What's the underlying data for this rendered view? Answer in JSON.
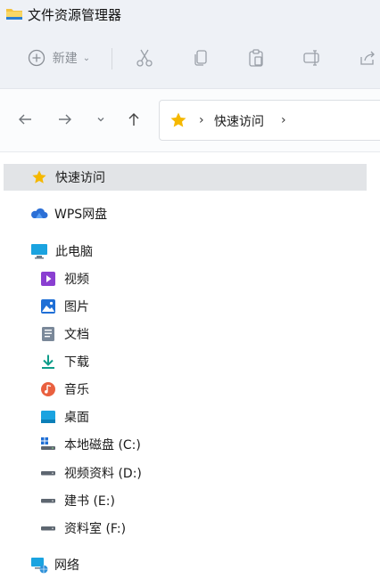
{
  "window": {
    "title": "文件资源管理器"
  },
  "toolbar": {
    "new_label": "新建"
  },
  "address": {
    "crumb": "快速访问",
    "separator": "›"
  },
  "nav": {
    "quick_access": "快速访问",
    "wps": "WPS网盘",
    "this_pc": "此电脑",
    "folders": [
      "视频",
      "图片",
      "文档",
      "下载",
      "音乐",
      "桌面"
    ],
    "drives": [
      "本地磁盘 (C:)",
      "视频资料 (D:)",
      "建书 (E:)",
      "资料室 (F:)"
    ],
    "network": "网络"
  },
  "colors": {
    "accent": "#0a64c8",
    "star": "#f5b800",
    "selected_bg": "#e2e4e7",
    "toolbar_bg": "#eef1f6"
  },
  "icons": {
    "folder": "folder-icon",
    "star": "star-icon",
    "cloud": "cloud-icon",
    "pc": "monitor-icon",
    "network": "network-icon"
  }
}
